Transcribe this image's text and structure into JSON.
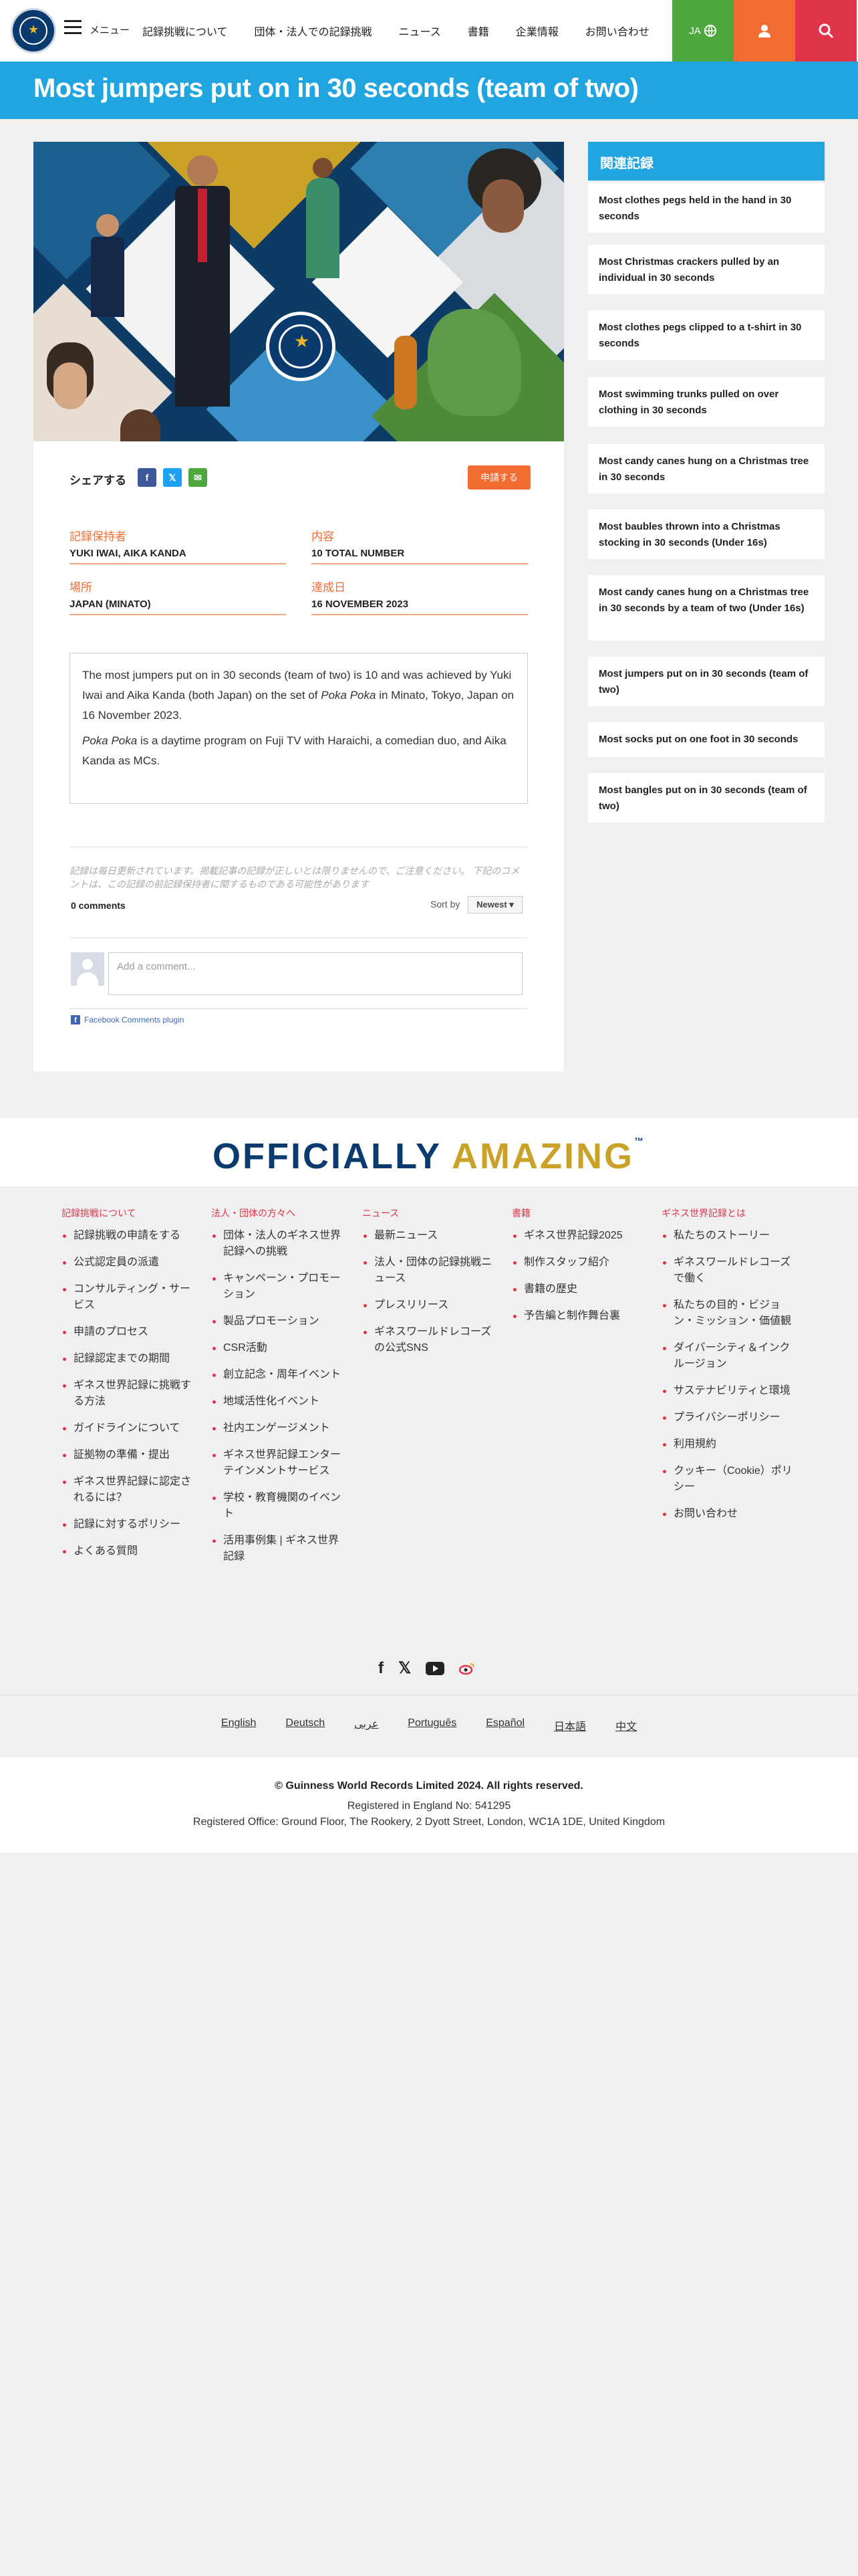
{
  "header": {
    "menu_label": "メニュー",
    "nav": [
      "記録挑戦について",
      "団体・法人での記録挑戦",
      "ニュース",
      "書籍",
      "企業情報",
      "お問い合わせ"
    ],
    "lang_label": "JA",
    "colors": {
      "lang": "#4fa83d",
      "user": "#f26c31",
      "search": "#e0344a"
    }
  },
  "title": "Most jumpers put on in 30 seconds (team of two)",
  "share": {
    "label": "シェアする",
    "apply_label": "申請する"
  },
  "fields": [
    {
      "label": "記録保持者",
      "value": "YUKI IWAI, AIKA KANDA"
    },
    {
      "label": "内容",
      "value": "10 TOTAL NUMBER"
    },
    {
      "label": "場所",
      "value": "JAPAN (MINATO)"
    },
    {
      "label": "達成日",
      "value": "16 NOVEMBER 2023"
    }
  ],
  "description": {
    "p1_a": "The most jumpers put on in 30 seconds (team of two) is 10 and was achieved by Yuki Iwai and Aika Kanda (both Japan) on the set of ",
    "p1_em": "Poka Poka",
    "p1_b": " in Minato, Tokyo, Japan on 16 November 2023.",
    "p2_em": "Poka Poka",
    "p2_b": " is a daytime program on Fuji TV with Haraichi, a comedian duo, and Aika Kanda as MCs."
  },
  "comments": {
    "notice": "記録は毎日更新されています。掲載記事の記録が正しいとは限りませんので、ご注意ください。 下記のコメントは、この記録の前記録保持者に関するものである可能性があります",
    "count": "0 comments",
    "sort_label": "Sort by",
    "sort_value": "Newest ▾",
    "placeholder": "Add a comment...",
    "plugin": "Facebook Comments plugin"
  },
  "sidebar": {
    "heading": "関連記録",
    "items": [
      "Most clothes pegs held in the hand in 30 seconds",
      "Most Christmas crackers pulled by an individual in 30 seconds",
      "Most clothes pegs clipped to a t-shirt in 30 seconds",
      "Most swimming trunks pulled on over clothing in 30 seconds",
      "Most candy canes hung on a Christmas tree in 30 seconds",
      "Most baubles thrown into a Christmas stocking in 30 seconds (Under 16s)",
      "Most candy canes hung on a Christmas tree in 30 seconds by a team of two (Under 16s)",
      "Most jumpers put on in 30 seconds (team of two)",
      "Most socks put on one foot in 30 seconds",
      "Most bangles put on in 30 seconds (team of two)"
    ]
  },
  "banner": {
    "word1": "OFFICIALLY",
    "word2": "AMAZING",
    "tm": "™"
  },
  "footer": {
    "columns": [
      {
        "heading": "記録挑戦について",
        "items": [
          "記録挑戦の申請をする",
          "公式認定員の派遣",
          "コンサルティング・サービス",
          "申請のプロセス",
          "記録認定までの期間",
          "ギネス世界記録に挑戦する方法",
          "ガイドラインについて",
          "証拠物の準備・提出",
          "ギネス世界記録に認定されるには？",
          "記録に対するポリシー",
          "よくある質問"
        ]
      },
      {
        "heading": "法人・団体の方々へ",
        "items": [
          "団体・法人のギネス世界記録への挑戦",
          "キャンペーン・プロモーション",
          "製品プロモーション",
          "CSR活動",
          "創立記念・周年イベント",
          "地域活性化イベント",
          "社内エンゲージメント",
          "ギネス世界記録エンターテインメントサービス",
          "学校・教育機関のイベント",
          "活用事例集 | ギネス世界記録"
        ]
      },
      {
        "heading": "ニュース",
        "items": [
          "最新ニュース",
          "法人・団体の記録挑戦ニュース",
          "プレスリリース",
          "ギネスワールドレコーズの公式SNS"
        ]
      },
      {
        "heading": "書籍",
        "items": [
          "ギネス世界記録2025",
          "制作スタッフ紹介",
          "書籍の歴史",
          "予告編と制作舞台裏"
        ]
      },
      {
        "heading": "ギネス世界記録とは",
        "items": [
          "私たちのストーリー",
          "ギネスワールドレコーズで働く",
          "私たちの目的・ビジョン・ミッション・価値観",
          "ダイバーシティ＆インクルージョン",
          "サステナビリティと環境",
          "プライバシーポリシー",
          "利用規約",
          "クッキー（Cookie）ポリシー",
          "お問い合わせ"
        ]
      }
    ],
    "social_icons": [
      "facebook-icon",
      "x-icon",
      "youtube-icon",
      "weibo-icon"
    ],
    "languages": [
      "English",
      "Deutsch",
      "عربى",
      "Português",
      "Español",
      "日本語",
      "中文"
    ],
    "copyright": "© Guinness World Records Limited 2024. All rights reserved.",
    "registered": "Registered in England No: 541295",
    "office": "Registered Office: Ground Floor, The Rookery, 2 Dyott Street, London, WC1A 1DE, United Kingdom"
  }
}
